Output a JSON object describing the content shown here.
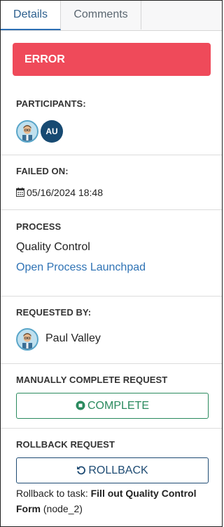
{
  "tabs": [
    {
      "label": "Details",
      "active": true
    },
    {
      "label": "Comments",
      "active": false
    }
  ],
  "status": {
    "label": "ERROR",
    "color": "#ef4a5a"
  },
  "participants": {
    "label": "PARTICIPANTS:",
    "users": [
      {
        "type": "photo",
        "icon": "person-avatar"
      },
      {
        "type": "initials",
        "initials": "AU"
      }
    ]
  },
  "failed_on": {
    "label": "FAILED ON:",
    "date": "05/16/2024 18:48",
    "icon": "calendar-icon"
  },
  "process": {
    "label": "PROCESS",
    "name": "Quality Control",
    "link": "Open Process Launchpad"
  },
  "requested_by": {
    "label": "REQUESTED BY:",
    "name": "Paul Valley"
  },
  "manual_complete": {
    "label": "MANUALLY COMPLETE REQUEST",
    "button": "COMPLETE",
    "icon": "stop-circle-icon",
    "color": "#2a8a5e"
  },
  "rollback": {
    "label": "ROLLBACK REQUEST",
    "button": "ROLLBACK",
    "icon": "undo-icon",
    "color": "#1e4b73",
    "note_prefix": "Rollback to task: ",
    "task_name": "Fill out Quality Control Form",
    "node": " (node_2)"
  }
}
